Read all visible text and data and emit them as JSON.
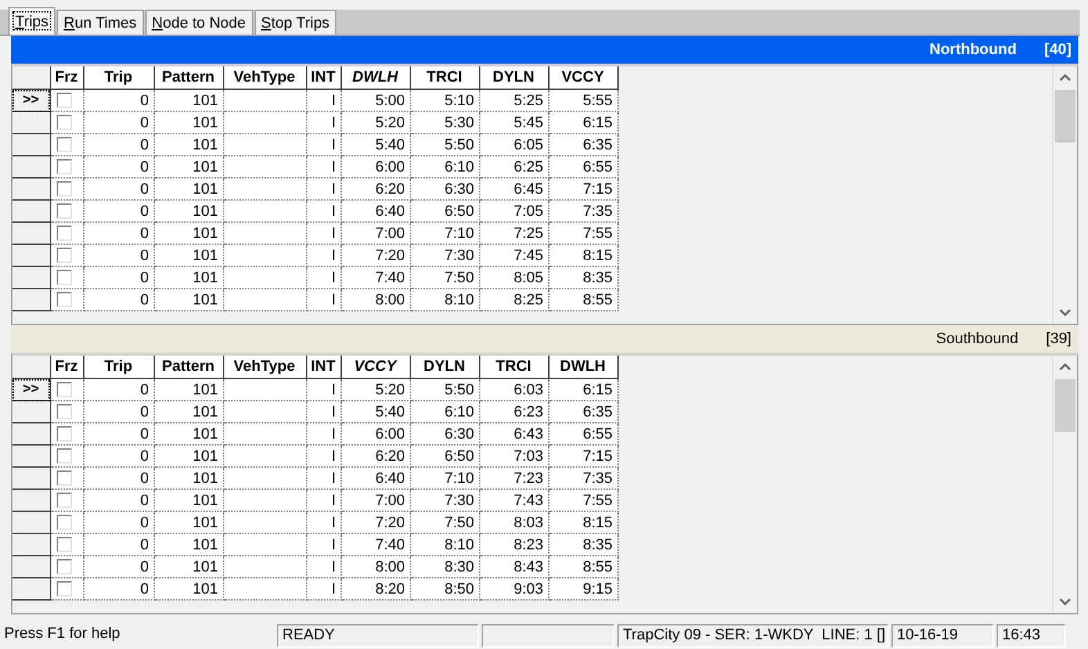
{
  "tabs": [
    {
      "label": "Trips",
      "selected": true
    },
    {
      "label": "Run Times",
      "selected": false
    },
    {
      "label": "Node to Node",
      "selected": false
    },
    {
      "label": "Stop Trips",
      "selected": false
    }
  ],
  "sections": [
    {
      "title": "Northbound",
      "count": "[40]",
      "active": true,
      "columns": [
        {
          "label": "Frz",
          "italic": false
        },
        {
          "label": "Trip",
          "italic": false
        },
        {
          "label": "Pattern",
          "italic": false
        },
        {
          "label": "VehType",
          "italic": false
        },
        {
          "label": "INT",
          "italic": false
        },
        {
          "label": "DWLH",
          "italic": true
        },
        {
          "label": "TRCI",
          "italic": false
        },
        {
          "label": "DYLN",
          "italic": false
        },
        {
          "label": "VCCY",
          "italic": false
        }
      ],
      "rows": [
        {
          "marker": ">>",
          "current": true,
          "frozen": false,
          "trip": "0",
          "pattern": "101",
          "int": "I",
          "times": [
            "5:00",
            "5:10",
            "5:25",
            "5:55"
          ]
        },
        {
          "current": false,
          "frozen": false,
          "trip": "0",
          "pattern": "101",
          "int": "I",
          "times": [
            "5:20",
            "5:30",
            "5:45",
            "6:15"
          ]
        },
        {
          "current": false,
          "frozen": false,
          "trip": "0",
          "pattern": "101",
          "int": "I",
          "times": [
            "5:40",
            "5:50",
            "6:05",
            "6:35"
          ]
        },
        {
          "current": false,
          "frozen": false,
          "trip": "0",
          "pattern": "101",
          "int": "I",
          "times": [
            "6:00",
            "6:10",
            "6:25",
            "6:55"
          ]
        },
        {
          "current": false,
          "frozen": false,
          "trip": "0",
          "pattern": "101",
          "int": "I",
          "times": [
            "6:20",
            "6:30",
            "6:45",
            "7:15"
          ]
        },
        {
          "current": false,
          "frozen": false,
          "trip": "0",
          "pattern": "101",
          "int": "I",
          "times": [
            "6:40",
            "6:50",
            "7:05",
            "7:35"
          ]
        },
        {
          "current": false,
          "frozen": false,
          "trip": "0",
          "pattern": "101",
          "int": "I",
          "times": [
            "7:00",
            "7:10",
            "7:25",
            "7:55"
          ]
        },
        {
          "current": false,
          "frozen": false,
          "trip": "0",
          "pattern": "101",
          "int": "I",
          "times": [
            "7:20",
            "7:30",
            "7:45",
            "8:15"
          ]
        },
        {
          "current": false,
          "frozen": false,
          "trip": "0",
          "pattern": "101",
          "int": "I",
          "times": [
            "7:40",
            "7:50",
            "8:05",
            "8:35"
          ]
        },
        {
          "current": false,
          "frozen": false,
          "trip": "0",
          "pattern": "101",
          "int": "I",
          "times": [
            "8:00",
            "8:10",
            "8:25",
            "8:55"
          ]
        }
      ]
    },
    {
      "title": "Southbound",
      "count": "[39]",
      "active": false,
      "columns": [
        {
          "label": "Frz",
          "italic": false
        },
        {
          "label": "Trip",
          "italic": false
        },
        {
          "label": "Pattern",
          "italic": false
        },
        {
          "label": "VehType",
          "italic": false
        },
        {
          "label": "INT",
          "italic": false
        },
        {
          "label": "VCCY",
          "italic": true
        },
        {
          "label": "DYLN",
          "italic": false
        },
        {
          "label": "TRCI",
          "italic": false
        },
        {
          "label": "DWLH",
          "italic": false
        }
      ],
      "rows": [
        {
          "marker": ">>",
          "current": true,
          "frozen": false,
          "trip": "0",
          "pattern": "101",
          "int": "I",
          "times": [
            "5:20",
            "5:50",
            "6:03",
            "6:15"
          ]
        },
        {
          "current": false,
          "frozen": false,
          "trip": "0",
          "pattern": "101",
          "int": "I",
          "times": [
            "5:40",
            "6:10",
            "6:23",
            "6:35"
          ]
        },
        {
          "current": false,
          "frozen": false,
          "trip": "0",
          "pattern": "101",
          "int": "I",
          "times": [
            "6:00",
            "6:30",
            "6:43",
            "6:55"
          ]
        },
        {
          "current": false,
          "frozen": false,
          "trip": "0",
          "pattern": "101",
          "int": "I",
          "times": [
            "6:20",
            "6:50",
            "7:03",
            "7:15"
          ]
        },
        {
          "current": false,
          "frozen": false,
          "trip": "0",
          "pattern": "101",
          "int": "I",
          "times": [
            "6:40",
            "7:10",
            "7:23",
            "7:35"
          ]
        },
        {
          "current": false,
          "frozen": false,
          "trip": "0",
          "pattern": "101",
          "int": "I",
          "times": [
            "7:00",
            "7:30",
            "7:43",
            "7:55"
          ]
        },
        {
          "current": false,
          "frozen": false,
          "trip": "0",
          "pattern": "101",
          "int": "I",
          "times": [
            "7:20",
            "7:50",
            "8:03",
            "8:15"
          ]
        },
        {
          "current": false,
          "frozen": false,
          "trip": "0",
          "pattern": "101",
          "int": "I",
          "times": [
            "7:40",
            "8:10",
            "8:23",
            "8:35"
          ]
        },
        {
          "current": false,
          "frozen": false,
          "trip": "0",
          "pattern": "101",
          "int": "I",
          "times": [
            "8:00",
            "8:30",
            "8:43",
            "8:55"
          ]
        },
        {
          "current": false,
          "frozen": false,
          "trip": "0",
          "pattern": "101",
          "int": "I",
          "times": [
            "8:20",
            "8:50",
            "9:03",
            "9:15"
          ]
        }
      ]
    }
  ],
  "status_bar": [
    {
      "kind": "text",
      "text": "Press F1 for help"
    },
    {
      "kind": "text",
      "text": "READY"
    },
    {
      "kind": "blank"
    },
    {
      "kind": "text",
      "text": "TrapCity 09 - SER: 1-WKDY  LINE: 1 []"
    },
    {
      "kind": "text",
      "text": "10-16-19"
    },
    {
      "kind": "text",
      "text": "16:43"
    }
  ]
}
